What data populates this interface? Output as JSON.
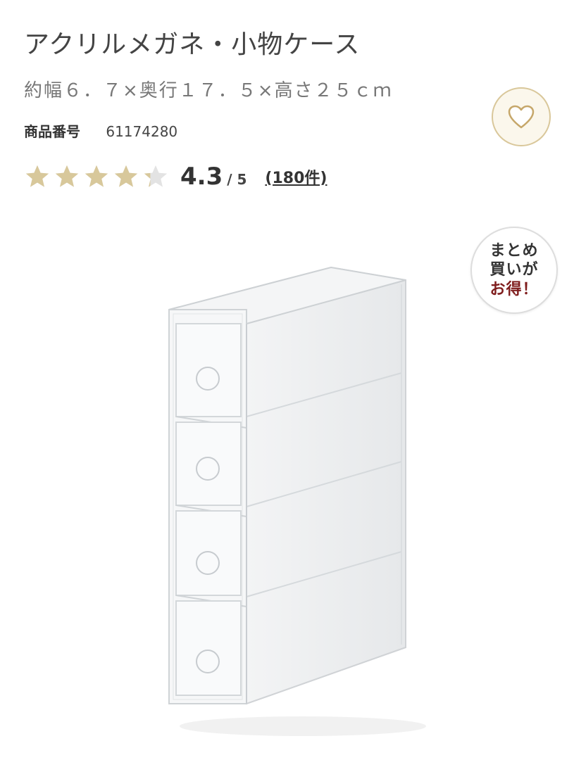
{
  "product": {
    "title": "アクリルメガネ・小物ケース",
    "size": "約幅６．７×奥行１７．５×高さ２５ｃｍ",
    "code_label": "商品番号",
    "code_value": "61174280"
  },
  "rating": {
    "score": "4.3",
    "scale": "/ 5",
    "reviews": "(180件)",
    "value": 4.3,
    "max": 5
  },
  "badge": {
    "line1": "まとめ",
    "line2": "買いが",
    "line3": "お得！"
  },
  "icons": {
    "favorite": "heart-icon",
    "star": "star-icon"
  },
  "colors": {
    "star_filled": "#d8c89b",
    "star_empty": "#e3e3e3",
    "heart_outline": "#c6a76a",
    "badge_accent": "#7f1d1d"
  }
}
